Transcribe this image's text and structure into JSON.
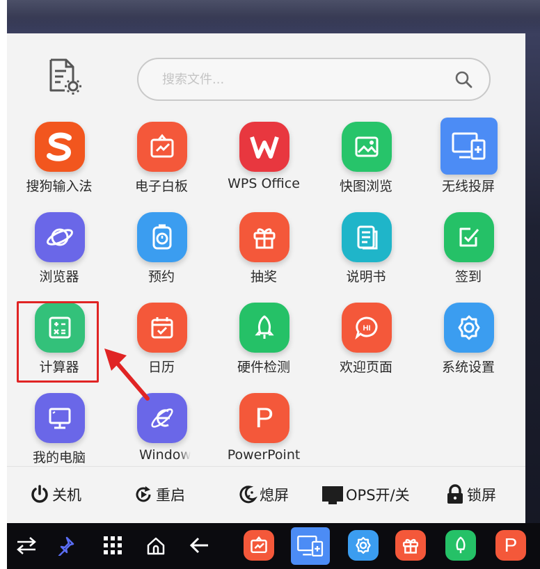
{
  "search": {
    "placeholder": "搜索文件..."
  },
  "apps": [
    {
      "name": "sogou-input",
      "label": "搜狗输入法",
      "color": "#f2561e",
      "icon": "sogou-s-icon"
    },
    {
      "name": "whiteboard",
      "label": "电子白板",
      "color": "#f4583a",
      "icon": "whiteboard-icon"
    },
    {
      "name": "wps-office",
      "label": "WPS Office",
      "color": "#e8373f",
      "icon": "wps-w-icon"
    },
    {
      "name": "image-viewer",
      "label": "快图浏览",
      "color": "#27c46a",
      "icon": "picture-icon"
    },
    {
      "name": "wireless-cast",
      "label": "无线投屏",
      "color": "#4c8cf5",
      "icon": "screen-cast-icon"
    },
    {
      "name": "browser",
      "label": "浏览器",
      "color": "#6a67e8",
      "icon": "planet-icon"
    },
    {
      "name": "appointment",
      "label": "预约",
      "color": "#3b9df0",
      "icon": "timer-icon"
    },
    {
      "name": "lottery",
      "label": "抽奖",
      "color": "#f4583a",
      "icon": "gift-icon"
    },
    {
      "name": "manual",
      "label": "说明书",
      "color": "#1fb5c9",
      "icon": "document-icon"
    },
    {
      "name": "sign-in",
      "label": "签到",
      "color": "#25c167",
      "icon": "edit-check-icon"
    },
    {
      "name": "calculator",
      "label": "计算器",
      "color": "#33c17a",
      "icon": "calculator-icon"
    },
    {
      "name": "calendar",
      "label": "日历",
      "color": "#f4583a",
      "icon": "calendar-icon"
    },
    {
      "name": "hardware-check",
      "label": "硬件检测",
      "color": "#25c167",
      "icon": "rocket-icon"
    },
    {
      "name": "welcome-page",
      "label": "欢迎页面",
      "color": "#f4583a",
      "icon": "hi-bubble-icon"
    },
    {
      "name": "system-settings",
      "label": "系统设置",
      "color": "#3b9df0",
      "icon": "gear-icon"
    },
    {
      "name": "my-computer",
      "label": "我的电脑",
      "color": "#6a67e8",
      "icon": "monitor-icon"
    },
    {
      "name": "windows",
      "label": "Windows",
      "color": "#6a67e8",
      "icon": "windows-browser-icon"
    },
    {
      "name": "powerpoint",
      "label": "PowerPoint",
      "color": "#f4583a",
      "icon": "powerpoint-p-icon"
    }
  ],
  "power": {
    "shutdown": "关机",
    "restart": "重启",
    "screen_off": "熄屏",
    "ops_toggle": "OPS开/关",
    "lock": "锁屏"
  },
  "taskbar_apps": [
    {
      "name": "whiteboard",
      "color": "#f4583a"
    },
    {
      "name": "wireless-cast",
      "color": "#4c8cf5"
    },
    {
      "name": "system-settings",
      "color": "#3b9df0"
    },
    {
      "name": "lottery",
      "color": "#f4583a"
    },
    {
      "name": "hardware-check",
      "color": "#25c167"
    },
    {
      "name": "powerpoint",
      "color": "#f4583a"
    }
  ]
}
